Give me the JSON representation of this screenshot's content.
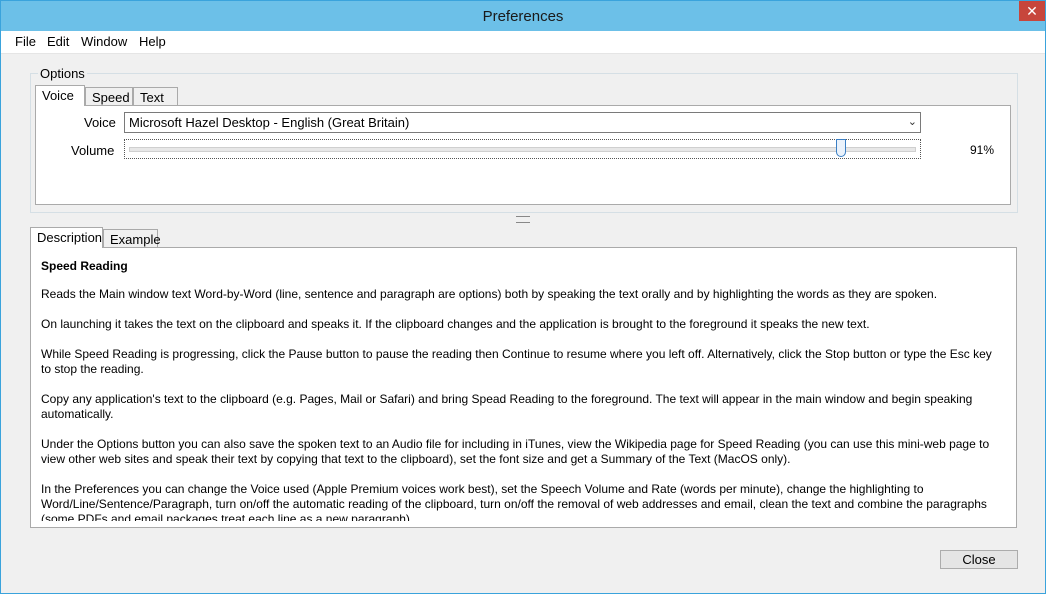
{
  "window": {
    "title": "Preferences",
    "close_glyph": "✕"
  },
  "menu": [
    "File",
    "Edit",
    "Window",
    "Help"
  ],
  "options": {
    "group_label": "Options",
    "tabs": [
      "Voice",
      "Speed",
      "Text"
    ],
    "voice_label": "Voice",
    "voice_value": "Microsoft Hazel Desktop - English (Great Britain)",
    "volume_label": "Volume",
    "volume_percent": 91,
    "volume_text": "91%"
  },
  "description": {
    "tabs": [
      "Description",
      "Example"
    ],
    "heading": "Speed Reading",
    "paragraphs": [
      "Reads the Main window text Word-by-Word (line, sentence and paragraph are options) both by speaking the text orally and by highlighting the words as they are spoken.",
      "On launching it takes the text on the clipboard and speaks it. If the clipboard changes and the application is brought to the foreground it speaks the new text.",
      "While Speed Reading is progressing, click the Pause button to pause the reading then Continue to resume where you left off. Alternatively, click the Stop button or type the Esc key to stop the reading.",
      "Copy any application's text to the clipboard (e.g. Pages, Mail or Safari) and bring Spead Reading to the foreground. The text will appear in the main window and begin speaking automatically.",
      "Under the Options button you can also save the spoken text to an Audio file for including in iTunes, view the Wikipedia page for Speed Reading (you can use this mini-web page to view other web sites and speak their text by copying that text to the clipboard), set the font size and get a Summary of the Text (MacOS only).",
      "In the Preferences you can change the Voice used (Apple Premium voices work best), set the Speech Volume and Rate (words per minute), change the highlighting to Word/Line/Sentence/Paragraph, turn on/off the automatic reading of the clipboard, turn on/off the removal of web addresses and email, clean the text and combine the paragraphs (some PDFs and email packages treat each line as a new paragraph)."
    ]
  },
  "buttons": {
    "close": "Close"
  },
  "icons": {
    "dropdown": "chevron-down-icon",
    "dropdown_glyph": "⌄"
  }
}
